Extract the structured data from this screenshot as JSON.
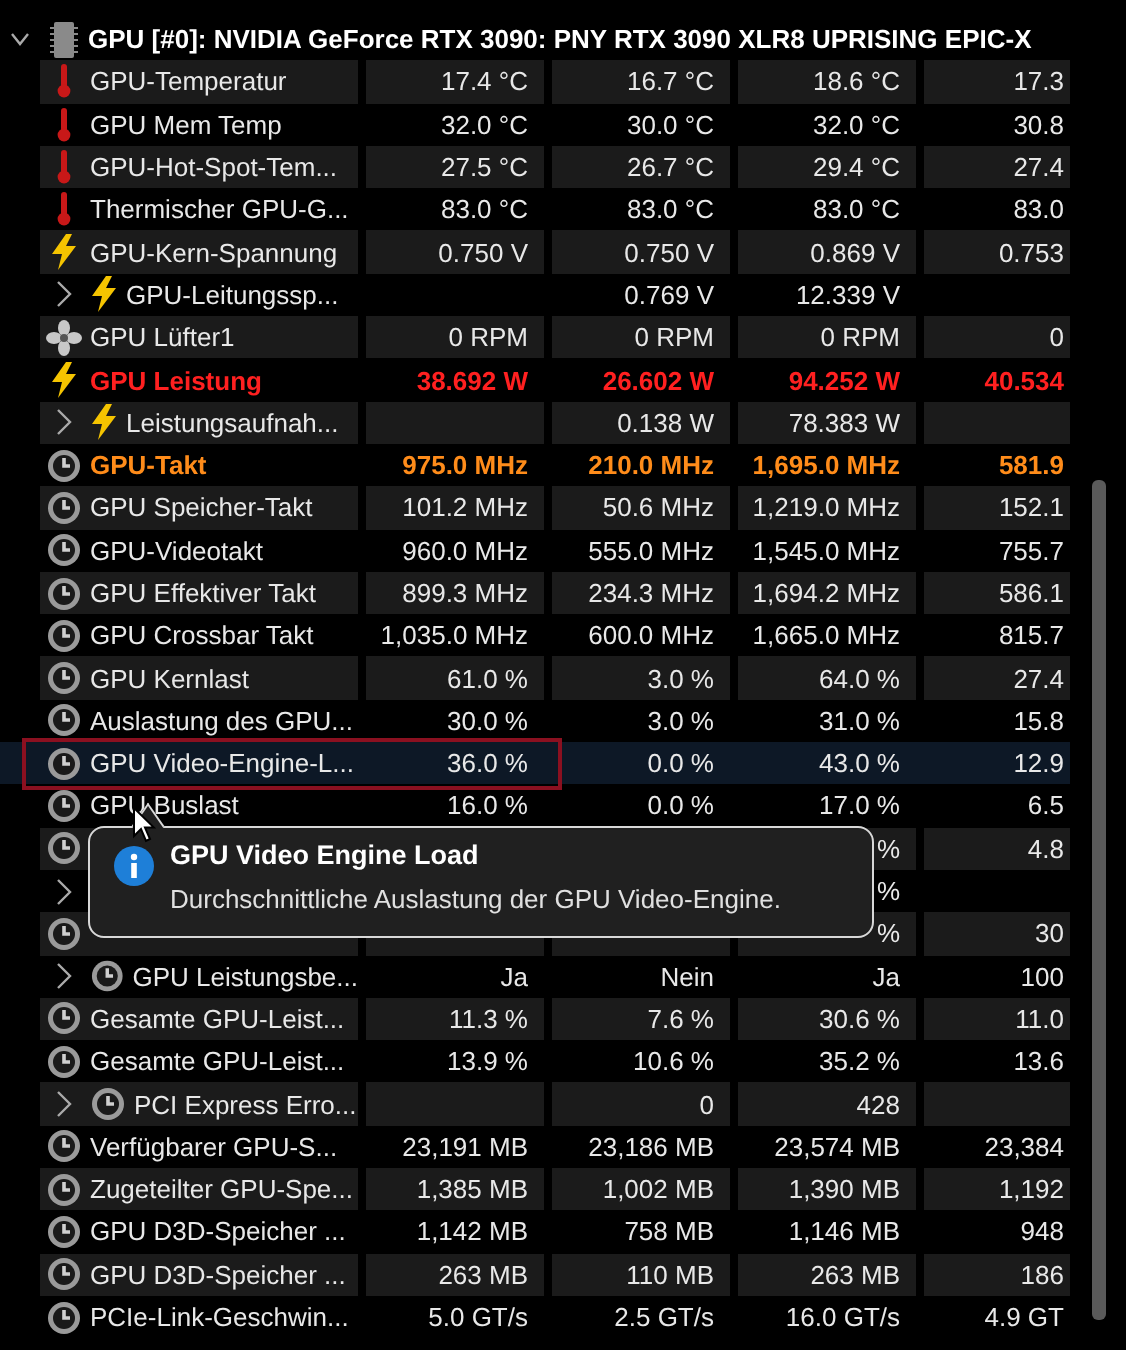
{
  "device": {
    "name": "GPU [#0]: NVIDIA GeForce RTX 3090: PNY RTX 3090 XLR8 UPRISING EPIC-X",
    "expanded": true
  },
  "sensors": [
    {
      "kind": "temp",
      "name": "GPU-Temperatur",
      "values": {
        "column_1": "17.4 °C",
        "column_2": "16.7 °C",
        "column_3": "18.6 °C",
        "column_4": "17.3"
      },
      "selected": false
    },
    {
      "kind": "temp",
      "name": "GPU Mem Temp",
      "values": {
        "column_1": "32.0 °C",
        "column_2": "30.0 °C",
        "column_3": "32.0 °C",
        "column_4": "30.8"
      },
      "selected": false
    },
    {
      "kind": "temp",
      "name": "GPU-Hot-Spot-Tem...",
      "values": {
        "column_1": "27.5 °C",
        "column_2": "26.7 °C",
        "column_3": "29.4 °C",
        "column_4": "27.4"
      },
      "selected": false
    },
    {
      "kind": "temp",
      "name": "Thermischer GPU-G...",
      "values": {
        "column_1": "83.0 °C",
        "column_2": "83.0 °C",
        "column_3": "83.0 °C",
        "column_4": "83.0"
      },
      "selected": false
    },
    {
      "kind": "voltage",
      "name": "GPU-Kern-Spannung",
      "values": {
        "column_1": "0.750 V",
        "column_2": "0.750 V",
        "column_3": "0.869 V",
        "column_4": "0.753"
      },
      "selected": false
    },
    {
      "kind": "voltage",
      "name": "GPU-Leitungssp...",
      "values": {
        "column_2": "0.769 V",
        "column_3": "12.339 V"
      },
      "selected": false,
      "expanded": false
    },
    {
      "kind": "fan",
      "name": "GPU Lüfter1",
      "values": {
        "column_1": "0 RPM",
        "column_2": "0 RPM",
        "column_3": "0 RPM",
        "column_4": "0"
      },
      "selected": false
    },
    {
      "kind": "voltage",
      "name": "GPU Leistung",
      "values": {
        "column_1": "38.692 W",
        "column_2": "26.602 W",
        "column_3": "94.252 W",
        "column_4": "40.534"
      },
      "selected": false,
      "color": "#ff2020"
    },
    {
      "kind": "voltage",
      "name": "Leistungsaufnah...",
      "values": {
        "column_2": "0.138 W",
        "column_3": "78.383 W"
      },
      "selected": false,
      "expanded": false
    },
    {
      "kind": "clock",
      "name": "GPU-Takt",
      "values": {
        "column_1": "975.0 MHz",
        "column_2": "210.0 MHz",
        "column_3": "1,695.0 MHz",
        "column_4": "581.9"
      },
      "selected": false,
      "color": "#ff8c1a"
    },
    {
      "kind": "clock",
      "name": "GPU Speicher-Takt",
      "values": {
        "column_1": "101.2 MHz",
        "column_2": "50.6 MHz",
        "column_3": "1,219.0 MHz",
        "column_4": "152.1"
      },
      "selected": false
    },
    {
      "kind": "clock",
      "name": "GPU-Videotakt",
      "values": {
        "column_1": "960.0 MHz",
        "column_2": "555.0 MHz",
        "column_3": "1,545.0 MHz",
        "column_4": "755.7"
      },
      "selected": false
    },
    {
      "kind": "clock",
      "name": "GPU Effektiver Takt",
      "values": {
        "column_1": "899.3 MHz",
        "column_2": "234.3 MHz",
        "column_3": "1,694.2 MHz",
        "column_4": "586.1"
      },
      "selected": false
    },
    {
      "kind": "clock",
      "name": "GPU Crossbar Takt",
      "values": {
        "column_1": "1,035.0 MHz",
        "column_2": "600.0 MHz",
        "column_3": "1,665.0 MHz",
        "column_4": "815.7"
      },
      "selected": false
    },
    {
      "kind": "clock",
      "name": "GPU Kernlast",
      "values": {
        "column_1": "61.0 %",
        "column_2": "3.0 %",
        "column_3": "64.0 %",
        "column_4": "27.4"
      },
      "selected": false
    },
    {
      "kind": "clock",
      "name": "Auslastung des GPU...",
      "values": {
        "column_1": "30.0 %",
        "column_2": "3.0 %",
        "column_3": "31.0 %",
        "column_4": "15.8"
      },
      "selected": false
    },
    {
      "kind": "clock",
      "name": "GPU Video-Engine-L...",
      "values": {
        "column_1": "36.0 %",
        "column_2": "0.0 %",
        "column_3": "43.0 %",
        "column_4": "12.9"
      },
      "selected": true,
      "marked": true
    },
    {
      "kind": "clock",
      "name": "GPU Buslast",
      "values": {
        "column_1": "16.0 %",
        "column_2": "0.0 %",
        "column_3": "17.0 %",
        "column_4": "6.5"
      },
      "selected": false
    },
    {
      "kind": "clock",
      "values": {
        "column_3": "%",
        "column_4": "4.8"
      },
      "selected": false
    },
    {
      "kind": "none",
      "values": {
        "column_3": "%"
      },
      "selected": false,
      "expanded": false
    },
    {
      "kind": "clock",
      "values": {
        "column_3": "%",
        "column_4": "30"
      },
      "selected": false
    },
    {
      "kind": "clock",
      "name": "GPU Leistungsbe...",
      "values": {
        "column_1": "Ja",
        "column_2": "Nein",
        "column_3": "Ja",
        "column_4": "100"
      },
      "selected": false,
      "expanded": false
    },
    {
      "kind": "clock",
      "name": "Gesamte GPU-Leist...",
      "values": {
        "column_1": "11.3 %",
        "column_2": "7.6 %",
        "column_3": "30.6 %",
        "column_4": "11.0"
      },
      "selected": false
    },
    {
      "kind": "clock",
      "name": "Gesamte GPU-Leist...",
      "values": {
        "column_1": "13.9 %",
        "column_2": "10.6 %",
        "column_3": "35.2 %",
        "column_4": "13.6"
      },
      "selected": false
    },
    {
      "kind": "clock",
      "name": "PCI Express Erro...",
      "values": {
        "column_2": "0",
        "column_3": "428"
      },
      "selected": false,
      "expanded": false
    },
    {
      "kind": "clock",
      "name": "Verfügbarer GPU-S...",
      "values": {
        "column_1": "23,191 MB",
        "column_2": "23,186 MB",
        "column_3": "23,574 MB",
        "column_4": "23,384"
      },
      "selected": false
    },
    {
      "kind": "clock",
      "name": "Zugeteilter GPU-Spe...",
      "values": {
        "column_1": "1,385 MB",
        "column_2": "1,002 MB",
        "column_3": "1,390 MB",
        "column_4": "1,192"
      },
      "selected": false
    },
    {
      "kind": "clock",
      "name": "GPU D3D-Speicher ...",
      "values": {
        "column_1": "1,142 MB",
        "column_2": "758 MB",
        "column_3": "1,146 MB",
        "column_4": "948"
      },
      "selected": false
    },
    {
      "kind": "clock",
      "name": "GPU D3D-Speicher ...",
      "values": {
        "column_1": "263 MB",
        "column_2": "110 MB",
        "column_3": "263 MB",
        "column_4": "186"
      },
      "selected": false
    },
    {
      "kind": "clock",
      "name": "PCIe-Link-Geschwin...",
      "values": {
        "column_1": "5.0 GT/s",
        "column_2": "2.5 GT/s",
        "column_3": "16.0 GT/s",
        "column_4": "4.9 GT"
      },
      "selected": false
    }
  ],
  "tooltip": {
    "title": "GPU Video Engine Load",
    "text": "Durchschnittliche Auslastung der GPU Video-Engine."
  }
}
